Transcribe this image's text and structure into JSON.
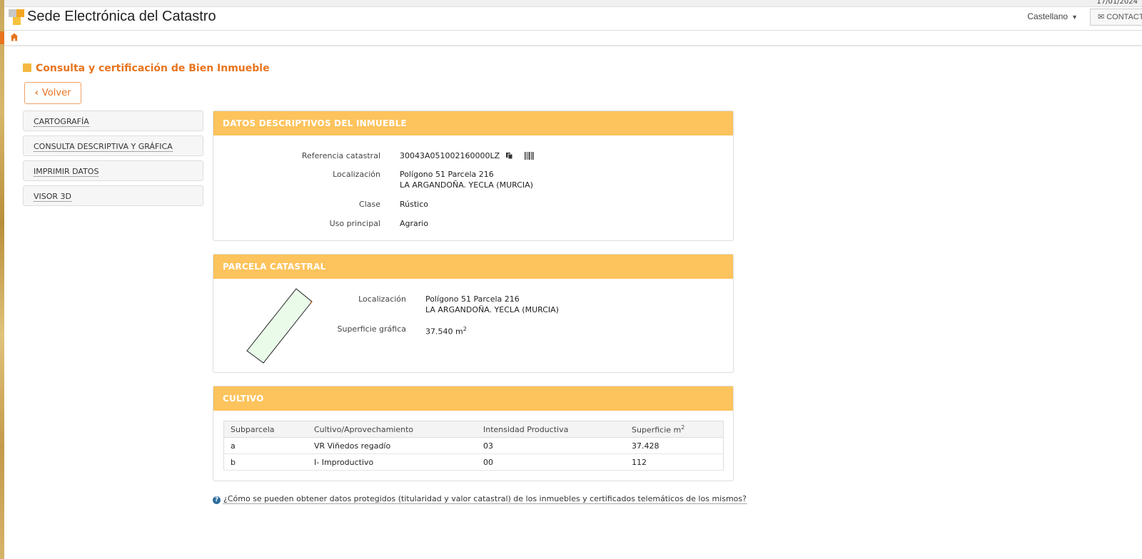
{
  "topbar": {
    "date": "17/01/2024"
  },
  "header": {
    "site_title": "Sede Electrónica del Catastro",
    "language": "Castellano",
    "contact_label": "CONTACTO"
  },
  "page": {
    "heading": "Consulta y certificación de Bien Inmueble",
    "back_label": "Volver"
  },
  "side_menu": [
    {
      "label": "CARTOGRAFÍA"
    },
    {
      "label": "CONSULTA DESCRIPTIVA Y GRÁFICA"
    },
    {
      "label": "IMPRIMIR DATOS"
    },
    {
      "label": "VISOR 3D"
    }
  ],
  "datos": {
    "title": "DATOS DESCRIPTIVOS DEL INMUEBLE",
    "ref_label": "Referencia catastral",
    "ref_value": "30043A051002160000LZ",
    "loc_label": "Localización",
    "loc_line1": "Polígono 51 Parcela 216",
    "loc_line2": "LA ARGANDOÑA. YECLA (MURCIA)",
    "clase_label": "Clase",
    "clase_value": "Rústico",
    "uso_label": "Uso principal",
    "uso_value": "Agrario"
  },
  "parcela": {
    "title": "PARCELA CATASTRAL",
    "loc_label": "Localización",
    "loc_line1": "Polígono 51 Parcela 216",
    "loc_line2": "LA ARGANDOÑA. YECLA (MURCIA)",
    "sup_label": "Superficie gráfica",
    "sup_value": "37.540 m",
    "sup_unit_sup": "2",
    "parcel_fill": "#eafbea"
  },
  "cultivo": {
    "title": "CULTIVO",
    "headers": [
      "Subparcela",
      "Cultivo/Aprovechamiento",
      "Intensidad Productiva",
      "Superficie m"
    ],
    "header_sup": "2",
    "rows": [
      [
        "a",
        "VR Viñedos regadío",
        "03",
        "37.428"
      ],
      [
        "b",
        "I- Improductivo",
        "00",
        "112"
      ]
    ]
  },
  "help": {
    "text": "¿Cómo se pueden obtener datos protegidos (titularidad y valor catastral) de los inmuebles y certificados telemáticos de los mismos?"
  },
  "colors": {
    "accent": "#e8741e",
    "panel_header": "#fdc35c"
  }
}
